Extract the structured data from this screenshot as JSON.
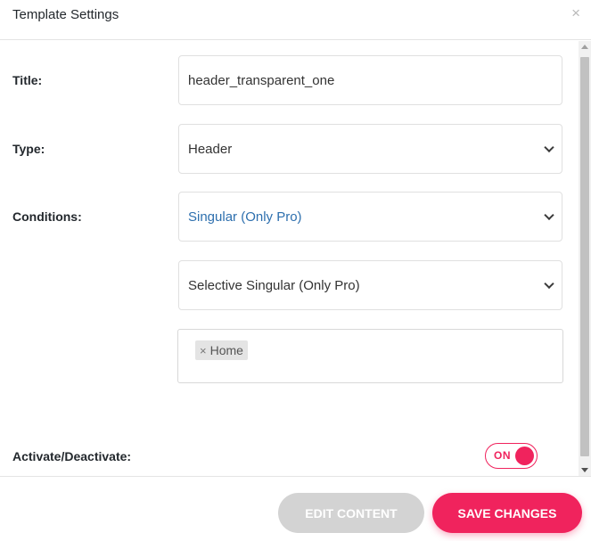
{
  "header": {
    "title": "Template Settings",
    "close_symbol": "×"
  },
  "form": {
    "title_label": "Title:",
    "title_value": "header_transparent_one",
    "type_label": "Type:",
    "type_value": "Header",
    "conditions_label": "Conditions:",
    "conditions_value": "Singular (Only Pro)",
    "conditions_sub_value": "Selective Singular (Only Pro)",
    "selected_tags": [
      {
        "remove_symbol": "×",
        "label": "Home"
      }
    ],
    "activate_label": "Activate/Deactivate:",
    "toggle_state": "ON"
  },
  "footer": {
    "edit_label": "EDIT CONTENT",
    "save_label": "SAVE CHANGES"
  },
  "colors": {
    "accent": "#f0235d",
    "link_blue": "#2d6fae",
    "disabled_button": "#d3d3d3"
  },
  "icons": [
    "close-icon",
    "chevron-down-icon",
    "tag-remove-icon",
    "toggle-switch"
  ]
}
